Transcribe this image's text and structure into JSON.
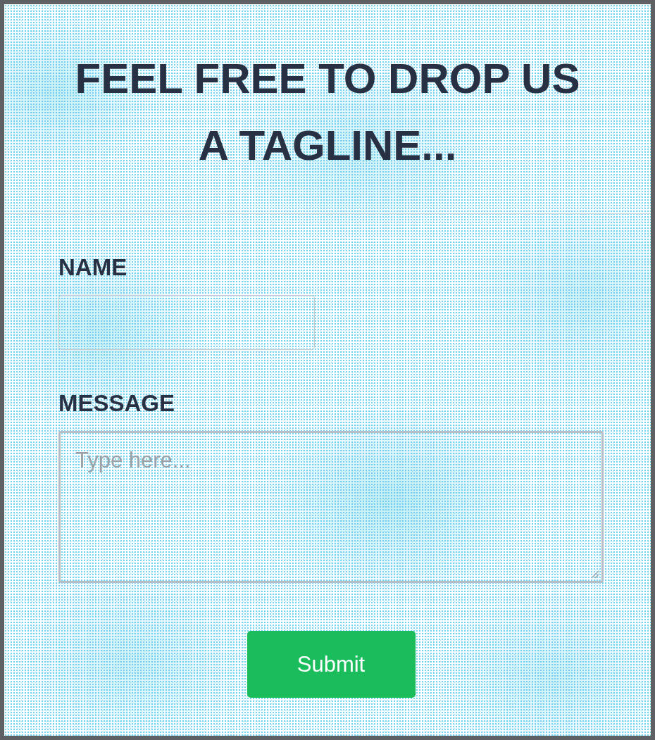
{
  "heading": "FEEL FREE TO DROP US A TAGLINE...",
  "fields": [
    {
      "kind": "input",
      "label": "NAME"
    },
    {
      "kind": "textarea",
      "label": "MESSAGE",
      "placeholder": "Type here..."
    }
  ],
  "submit_button": {
    "label": "Submit"
  }
}
